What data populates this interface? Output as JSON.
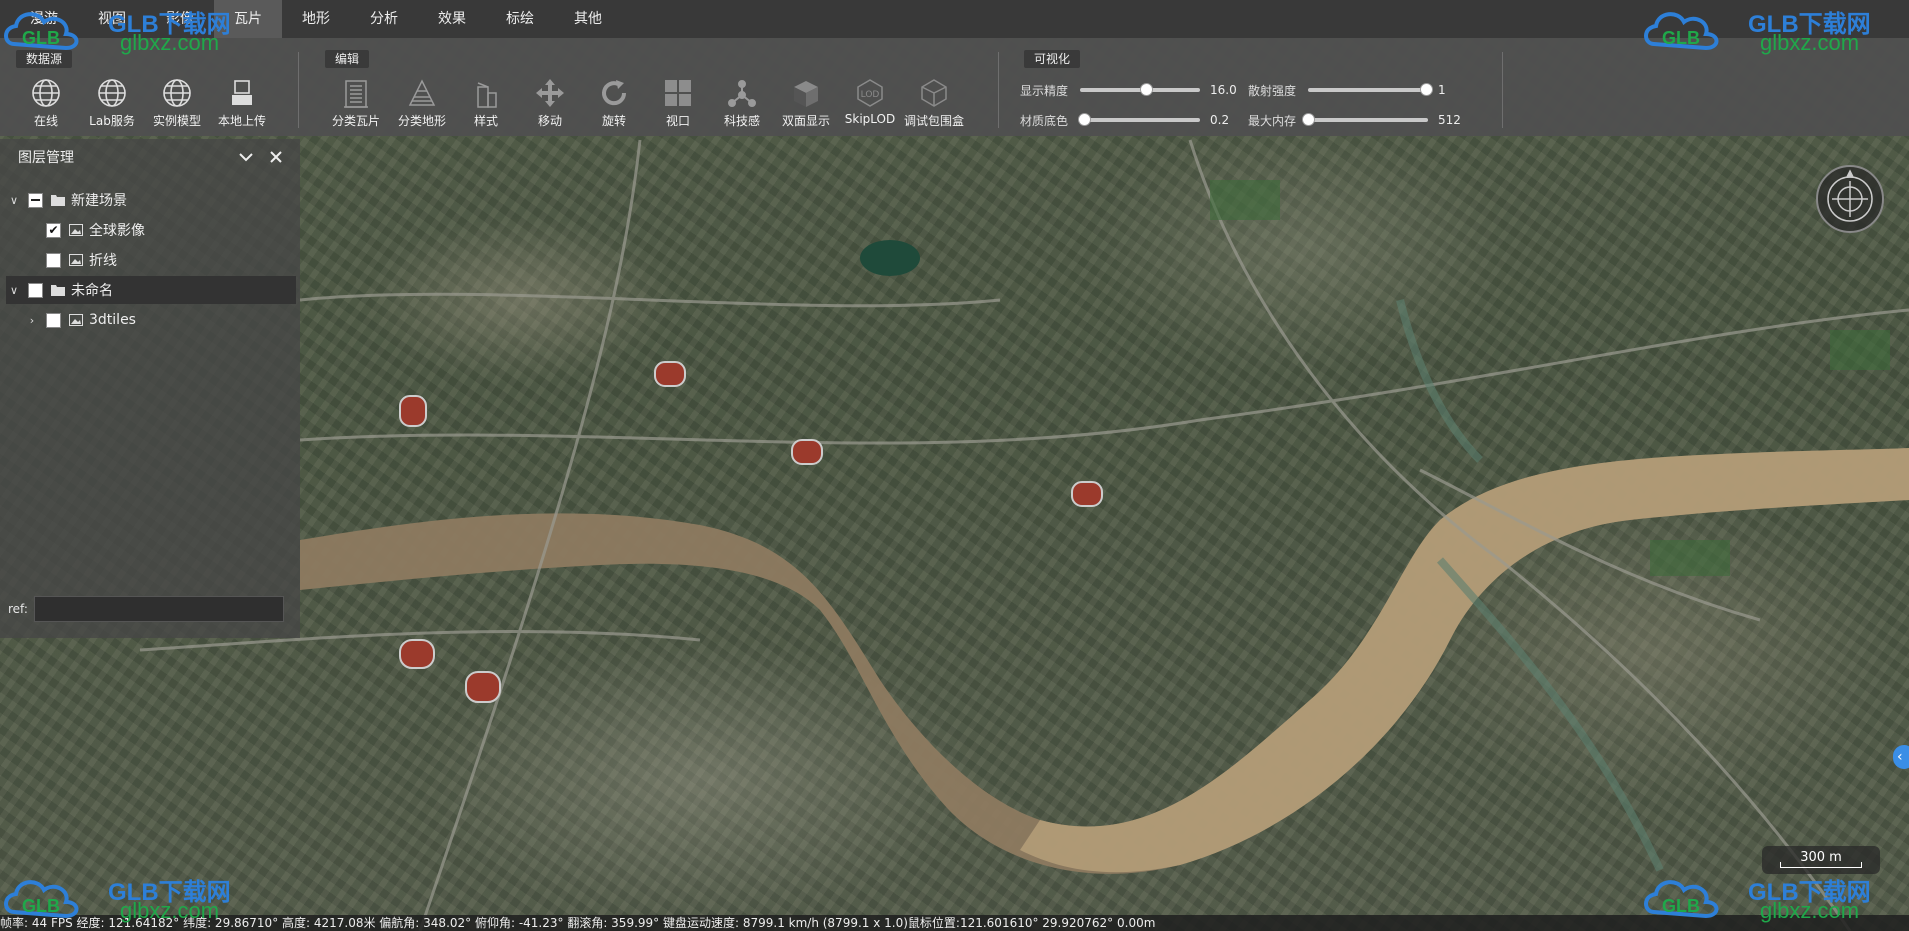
{
  "menu": {
    "items": [
      "漫游",
      "视图",
      "影像",
      "瓦片",
      "地形",
      "分析",
      "效果",
      "标绘",
      "其他"
    ],
    "active_index": 3
  },
  "ribbon": {
    "datasource": {
      "title": "数据源",
      "tools": [
        {
          "label": "在线",
          "icon": "globe-icon"
        },
        {
          "label": "Lab服务",
          "icon": "globe-icon"
        },
        {
          "label": "实例模型",
          "icon": "globe-icon"
        },
        {
          "label": "本地上传",
          "icon": "upload-icon"
        }
      ]
    },
    "edit": {
      "title": "编辑",
      "tools": [
        {
          "label": "分类瓦片",
          "icon": "classify-tile-icon"
        },
        {
          "label": "分类地形",
          "icon": "classify-terrain-icon"
        },
        {
          "label": "样式",
          "icon": "style-icon"
        },
        {
          "label": "移动",
          "icon": "move-icon"
        },
        {
          "label": "旋转",
          "icon": "rotate-icon"
        },
        {
          "label": "视口",
          "icon": "viewport-icon"
        },
        {
          "label": "科技感",
          "icon": "tech-icon"
        },
        {
          "label": "双面显示",
          "icon": "double-side-icon"
        },
        {
          "label": "SkipLOD",
          "icon": "lod-icon"
        },
        {
          "label": "调试包围盒",
          "icon": "bounding-box-icon"
        }
      ]
    },
    "visual": {
      "title": "可视化",
      "sliders": [
        {
          "label": "显示精度",
          "value": "16.0",
          "fraction": 0.55
        },
        {
          "label": "散射强度",
          "value": "1",
          "fraction": 0.98
        },
        {
          "label": "材质底色",
          "value": "0.2",
          "fraction": 0.03
        },
        {
          "label": "最大内存",
          "value": "512",
          "fraction": 0.0
        }
      ]
    }
  },
  "layer_panel": {
    "title": "图层管理",
    "tree": [
      {
        "label": "新建场景",
        "level": 0,
        "expanded": true,
        "check": "partial",
        "type": "folder"
      },
      {
        "label": "全球影像",
        "level": 1,
        "expanded": null,
        "check": "checked",
        "type": "image"
      },
      {
        "label": "折线",
        "level": 1,
        "expanded": null,
        "check": "unchecked",
        "type": "image"
      },
      {
        "label": "未命名",
        "level": 0,
        "expanded": true,
        "check": "unchecked",
        "type": "folder",
        "selected": true
      },
      {
        "label": "3dtiles",
        "level": 1,
        "expanded": false,
        "check": "unchecked",
        "type": "image"
      }
    ],
    "ref_label": "ref:",
    "ref_value": ""
  },
  "scale": {
    "text": "300 m"
  },
  "status": {
    "text": "帧率: 44 FPS 经度: 121.64182° 纬度: 29.86710° 高度: 4217.08米 偏航角: 348.02° 俯仰角: -41.23° 翻滚角: 359.99° 键盘运动速度: 8799.1 km/h (8799.1 x 1.0)鼠标位置:121.601610° 29.920762° 0.00m"
  },
  "watermark": {
    "brand": "GLB下载网",
    "site": "glbxz.com"
  },
  "colors": {
    "river": "#8f7a5c",
    "river_light": "#b9a07a",
    "accent": "#3a8ee6"
  }
}
